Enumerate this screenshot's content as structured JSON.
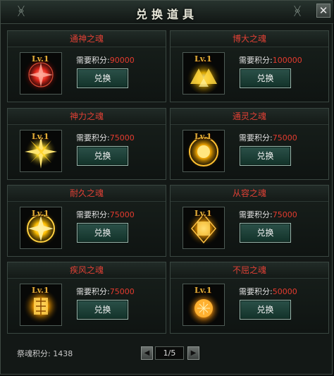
{
  "window": {
    "title": "兑换道具",
    "close_icon": "close-icon"
  },
  "cards": [
    {
      "name": "通神之魂",
      "level": "Lv.1",
      "cost_label": "需要积分:",
      "cost": "90000",
      "button": "兑换",
      "glow": "#d91e10"
    },
    {
      "name": "博大之魂",
      "level": "Lv.1",
      "cost_label": "需要积分:",
      "cost": "100000",
      "button": "兑换",
      "glow": "#f0c000"
    },
    {
      "name": "神力之魂",
      "level": "Lv.1",
      "cost_label": "需要积分:",
      "cost": "75000",
      "button": "兑换",
      "glow": "#ffd21e"
    },
    {
      "name": "通灵之魂",
      "level": "Lv.1",
      "cost_label": "需要积分:",
      "cost": "75000",
      "button": "兑换",
      "glow": "#f0a800"
    },
    {
      "name": "耐久之魂",
      "level": "Lv.1",
      "cost_label": "需要积分:",
      "cost": "75000",
      "button": "兑换",
      "glow": "#ffc400"
    },
    {
      "name": "从容之魂",
      "level": "Lv.1",
      "cost_label": "需要积分:",
      "cost": "75000",
      "button": "兑换",
      "glow": "#e89a00"
    },
    {
      "name": "疾风之魂",
      "level": "Lv.1",
      "cost_label": "需要积分:",
      "cost": "75000",
      "button": "兑换",
      "glow": "#f0a000"
    },
    {
      "name": "不屈之魂",
      "level": "Lv.1",
      "cost_label": "需要积分:",
      "cost": "50000",
      "button": "兑换",
      "glow": "#ff9a10"
    }
  ],
  "footer": {
    "points_label": "祭魂积分:",
    "points": "1438",
    "page": "1/5",
    "prev_icon": "prev-page-icon",
    "next_icon": "next-page-icon"
  },
  "colors": {
    "card_title": "#e04035",
    "cost_value": "#e53b2f",
    "button_bg": "#1f443b"
  }
}
